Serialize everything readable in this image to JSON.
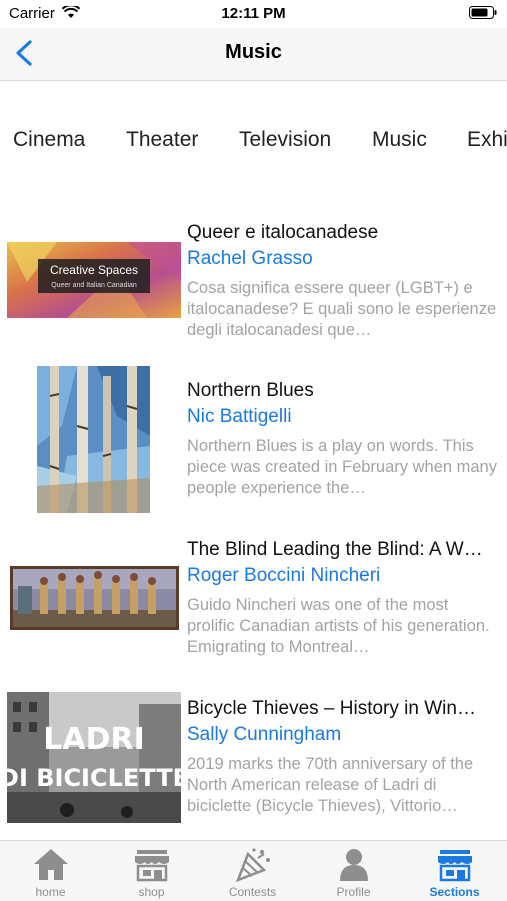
{
  "status_bar": {
    "carrier": "Carrier",
    "time": "12:11 PM"
  },
  "nav": {
    "title": "Music"
  },
  "categories": [
    "Cinema",
    "Theater",
    "Television",
    "Music",
    "Exhi"
  ],
  "items": [
    {
      "title": "Queer e italocanadese",
      "author": "Rachel Grasso",
      "description": "Cosa significa essere queer (LGBT+) e italocanadese? E quali sono le esperienze degli italocanadesi que…",
      "thumb_text": [
        "Creative Spaces",
        "Queer and Italian Canadian"
      ]
    },
    {
      "title": "Northern Blues",
      "author": "Nic Battigelli",
      "description": "Northern Blues is a play on words. This piece was created in February when many people experience the…"
    },
    {
      "title": "The Blind Leading the Blind: A W…",
      "author": "Roger Boccini Nincheri",
      "description": "Guido Nincheri was one of the most prolific Canadian artists of his generation. Emigrating to Montreal…"
    },
    {
      "title": "Bicycle Thieves – History in Win…",
      "author": "Sally Cunningham",
      "description": "2019 marks the 70th anniversary of the North American release of Ladri di biciclette (Bicycle Thieves), Vittorio…",
      "thumb_text": [
        "LADRI",
        "DI BICICLETTE"
      ]
    }
  ],
  "tabs": [
    {
      "label": "home",
      "icon": "home-icon"
    },
    {
      "label": "shop",
      "icon": "shop-icon"
    },
    {
      "label": "Contests",
      "icon": "confetti-icon"
    },
    {
      "label": "Profile",
      "icon": "profile-icon"
    },
    {
      "label": "Sections",
      "icon": "sections-icon",
      "active": true
    }
  ],
  "colors": {
    "accent": "#1a7ae0",
    "secondary_text": "#a3a3a3",
    "bar_bg": "#f7f7f7"
  }
}
